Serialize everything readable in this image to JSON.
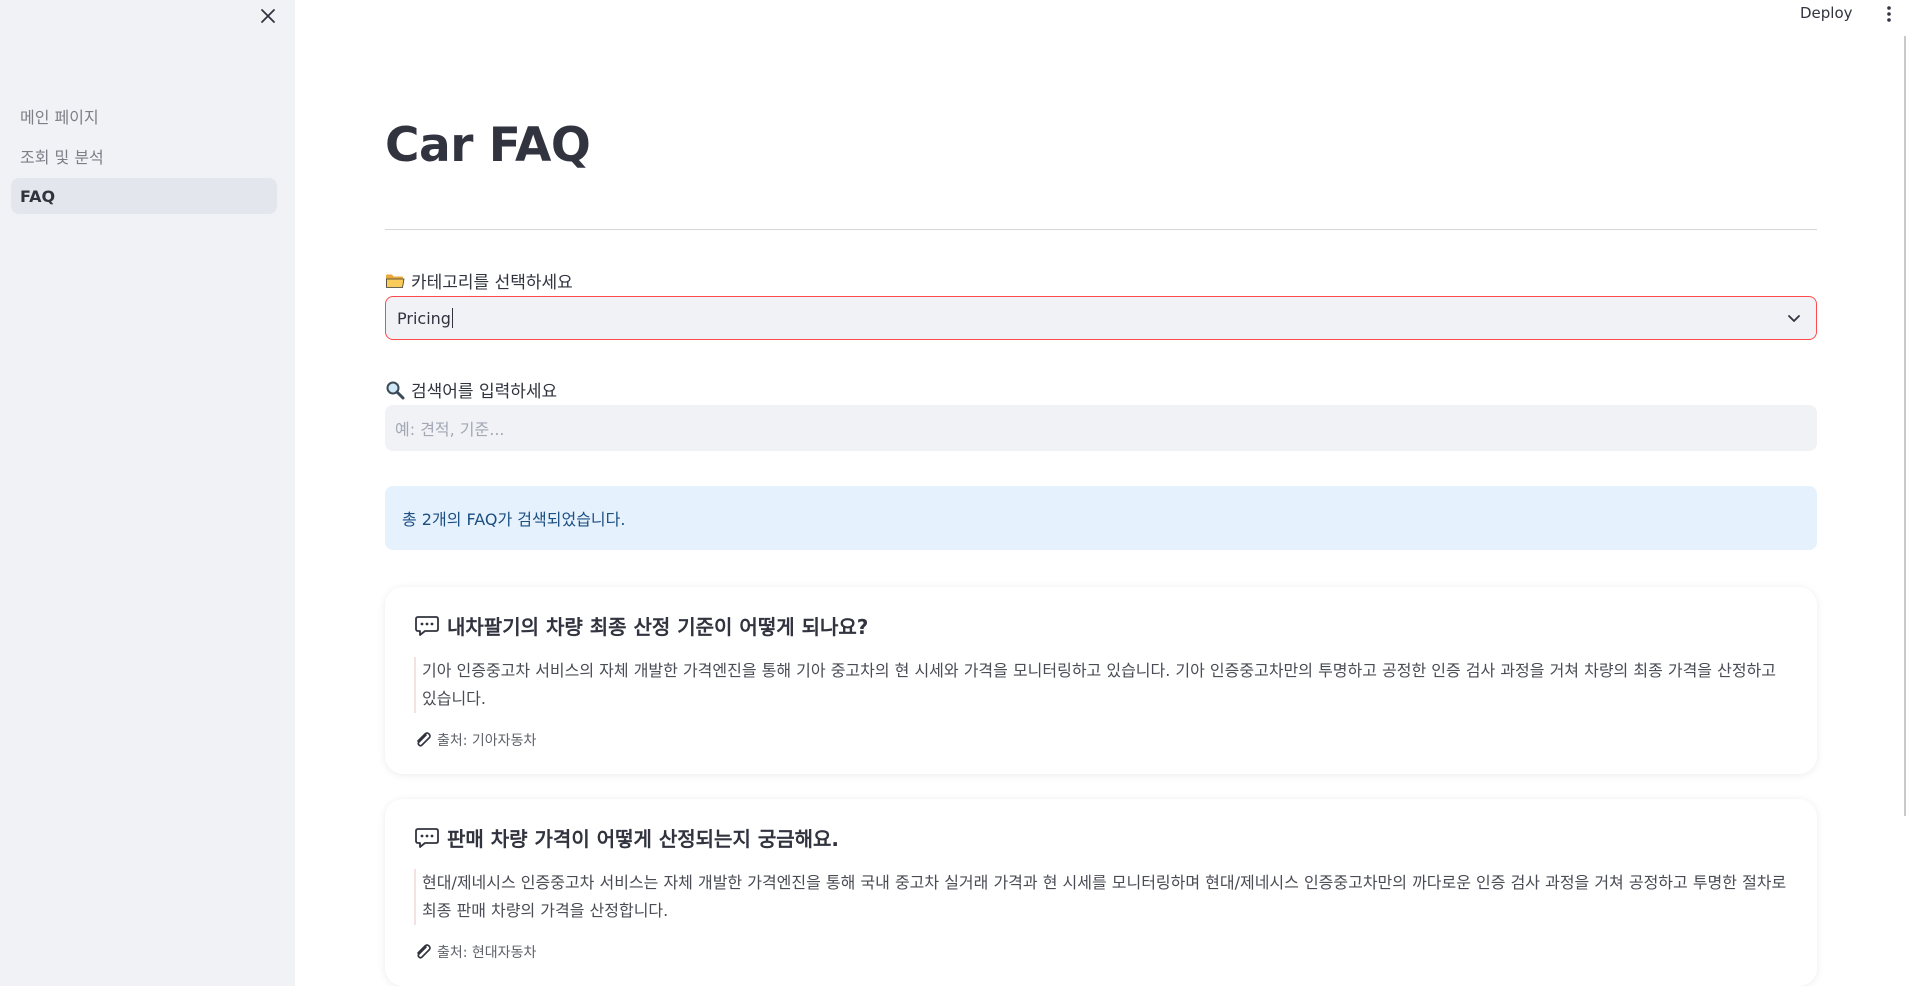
{
  "header": {
    "deploy_label": "Deploy"
  },
  "sidebar": {
    "items": [
      {
        "label": "메인 페이지"
      },
      {
        "label": "조회 및 분석"
      },
      {
        "label": "FAQ"
      }
    ]
  },
  "main": {
    "title": "Car FAQ",
    "category": {
      "label": "카테고리를 선택하세요",
      "value": "Pricing"
    },
    "search": {
      "label": "검색어를 입력하세요",
      "placeholder": "예: 견적, 기준..."
    },
    "result_text": "총 2개의 FAQ가 검색되었습니다.",
    "faqs": [
      {
        "question": "내차팔기의 차량 최종 산정 기준이 어떻게 되나요?",
        "answer": "기아 인증중고차 서비스의 자체 개발한 가격엔진을 통해 기아 중고차의 현 시세와 가격을 모니터링하고 있습니다. 기아 인증중고차만의 투명하고 공정한 인증 검사 과정을 거쳐 차량의 최종 가격을 산정하고 있습니다.",
        "source": "출처: 기아자동차"
      },
      {
        "question": "판매 차량 가격이 어떻게 산정되는지 궁금해요.",
        "answer": "현대/제네시스 인증중고차 서비스는 자체 개발한 가격엔진을 통해 국내 중고차 실거래 가격과 현 시세를 모니터링하며 현대/제네시스 인증중고차만의 까다로운 인증 검사 과정을 거쳐 공정하고 투명한 절차로 최종 판매 차량의 가격을 산정합니다.",
        "source": "출처: 현대자동차"
      }
    ]
  },
  "colors": {
    "accent": "#ff4b4b",
    "sidebar_bg": "#f0f2f6",
    "info_bg": "#e5f1fd"
  }
}
